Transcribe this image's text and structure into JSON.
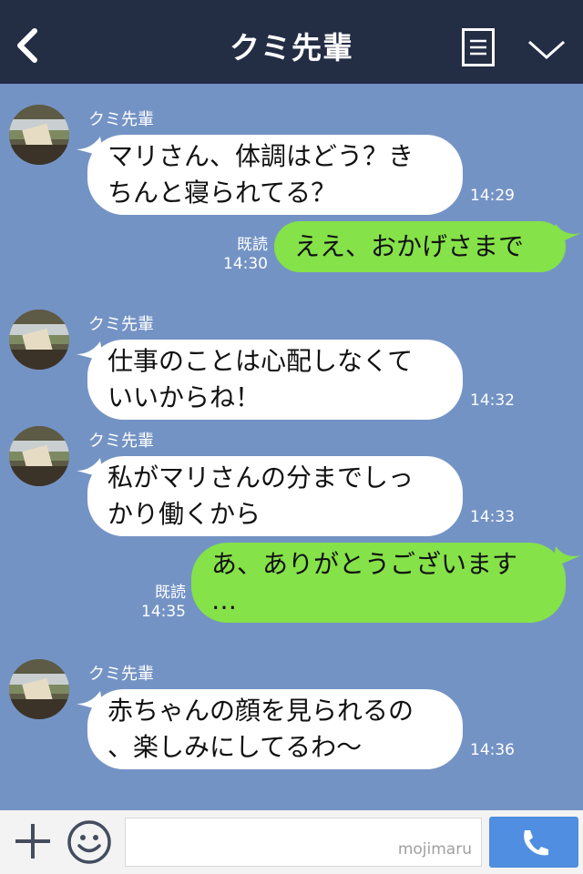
{
  "header": {
    "title": "クミ先輩",
    "back_icon": "chevron-left-icon",
    "menu_icon": "list-icon",
    "collapse_icon": "chevron-down-icon"
  },
  "messages": [
    {
      "from": "in",
      "sender": "クミ先輩",
      "text": "マリさん、体調はどう？き\nちんと寝られてる？",
      "time": "14:29"
    },
    {
      "from": "out",
      "text": "ええ、おかげさまで",
      "read": "既読",
      "time": "14:30"
    },
    {
      "from": "in",
      "sender": "クミ先輩",
      "text": "仕事のことは心配しなくて\nいいからね！",
      "time": "14:32"
    },
    {
      "from": "in",
      "sender": "クミ先輩",
      "text": "私がマリさんの分までしっ\nかり働くから",
      "time": "14:33"
    },
    {
      "from": "out",
      "text": "あ、ありがとうございます\n…",
      "read": "既読",
      "time": "14:35"
    },
    {
      "from": "in",
      "sender": "クミ先輩",
      "text": "赤ちゃんの顔を見られるの\n、楽しみにしてるわ〜",
      "time": "14:36"
    }
  ],
  "footer": {
    "watermark": "mojimaru",
    "plus_icon": "plus-icon",
    "emoji_icon": "smile-icon",
    "call_icon": "phone-icon"
  },
  "colors": {
    "header_bg": "#232d44",
    "chat_bg": "#7493c5",
    "incoming_bubble": "#ffffff",
    "outgoing_bubble": "#85e249",
    "call_button": "#4f8ee0"
  }
}
